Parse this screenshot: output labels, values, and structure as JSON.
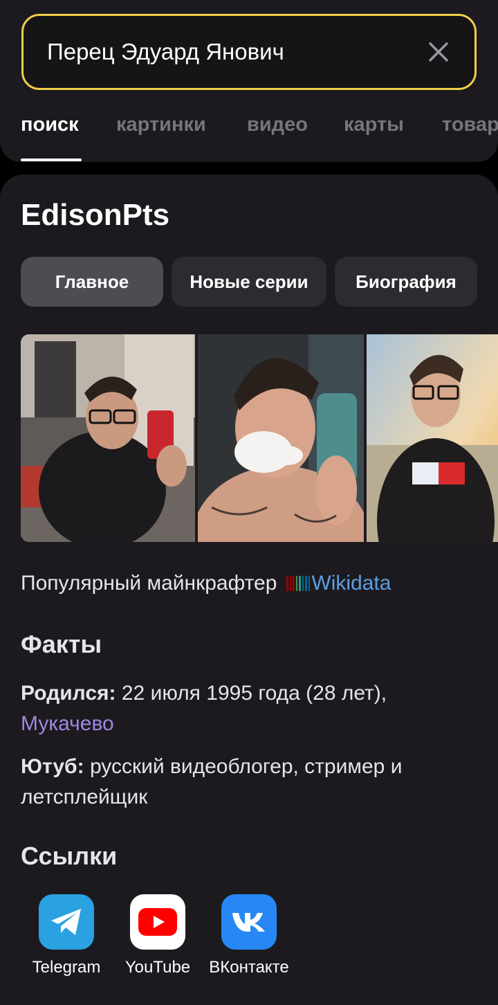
{
  "search": {
    "query": "Перец Эдуард Янович"
  },
  "tabs": [
    {
      "label": "поиск",
      "active": true
    },
    {
      "label": "картинки",
      "active": false
    },
    {
      "label": "видео",
      "active": false
    },
    {
      "label": "карты",
      "active": false
    },
    {
      "label": "товары",
      "active": false
    }
  ],
  "entity": {
    "title": "EdisonPts",
    "chips": [
      {
        "label": "Главное",
        "active": true
      },
      {
        "label": "Новые серии",
        "active": false
      },
      {
        "label": "Биография",
        "active": false
      }
    ],
    "description": "Популярный майнкрафтер",
    "source_link": "Wikidata"
  },
  "facts": {
    "heading": "Факты",
    "born_label": "Родился:",
    "born_value": "22 июля 1995 года (28 лет),",
    "born_place": "Мукачево",
    "youtube_label": "Ютуб:",
    "youtube_value": "русский видеоблогер, стример и летсплейщик"
  },
  "links": {
    "heading": "Ссылки",
    "items": [
      {
        "label": "Telegram",
        "icon": "telegram-icon",
        "color": "#2aa1e0"
      },
      {
        "label": "YouTube",
        "icon": "youtube-icon",
        "color": "#ff0000"
      },
      {
        "label": "ВКонтакте",
        "icon": "vk-icon",
        "color": "#2787f5"
      }
    ]
  },
  "colors": {
    "accent_search_border": "#f3cf4a",
    "link_blue": "#5b9fe3",
    "link_purple": "#a186e0"
  }
}
